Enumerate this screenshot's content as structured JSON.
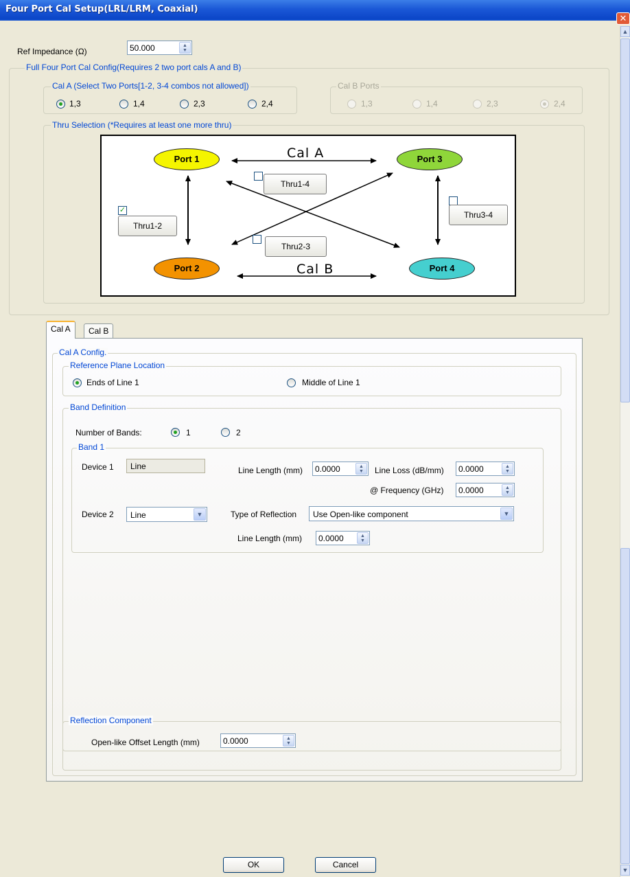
{
  "window": {
    "title": "Four Port Cal Setup(LRL/LRM, Coaxial)",
    "close_glyph": "✕"
  },
  "ref_impedance": {
    "label": "Ref Impedance (Ω)",
    "value": "50.000"
  },
  "full_config": {
    "title": "Full Four Port Cal Config(Requires 2 two port cals A and B)",
    "cal_a_ports": {
      "title": "Cal A (Select Two Ports[1-2, 3-4 combos not allowed])",
      "options": [
        "1,3",
        "1,4",
        "2,3",
        "2,4"
      ],
      "selected": "1,3"
    },
    "cal_b_ports": {
      "title": "Cal B Ports",
      "options": [
        "1,3",
        "1,4",
        "2,3",
        "2,4"
      ],
      "selected": "2,4",
      "enabled": false
    },
    "thru_selection": {
      "title": "Thru Selection (*Requires at least one more thru)",
      "ports": [
        "Port 1",
        "Port 2",
        "Port 3",
        "Port 4"
      ],
      "port_colors": {
        "port1": "#f5f500",
        "port2": "#f39200",
        "port3": "#8fd63a",
        "port4": "#45cfcf"
      },
      "cal_a_label": "Cal A",
      "cal_b_label": "Cal B",
      "thrus": [
        {
          "label": "Thru1-2",
          "checked": true
        },
        {
          "label": "Thru1-4",
          "checked": false
        },
        {
          "label": "Thru2-3",
          "checked": false
        },
        {
          "label": "Thru3-4",
          "checked": false
        }
      ]
    }
  },
  "tabs": [
    {
      "label": "Cal A",
      "active": true
    },
    {
      "label": "Cal B",
      "active": false
    }
  ],
  "cal_a_config": {
    "title": "Cal A Config.",
    "reference_plane": {
      "title": "Reference Plane Location",
      "options": [
        "Ends of Line 1",
        "Middle of Line 1"
      ],
      "selected": "Ends of Line 1"
    },
    "band_definition": {
      "title": "Band Definition",
      "number_of_bands_label": "Number of Bands:",
      "band_options": [
        "1",
        "2"
      ],
      "selected": "1",
      "band1": {
        "title": "Band 1",
        "device1_label": "Device 1",
        "device1_value": "Line",
        "line_length_label": "Line Length (mm)",
        "line_length_value": "0.0000",
        "line_loss_label": "Line Loss (dB/mm)",
        "line_loss_value": "0.0000",
        "frequency_label": "@ Frequency (GHz)",
        "frequency_value": "0.0000",
        "device2_label": "Device 2",
        "device2_value": "Line",
        "type_of_reflection_label": "Type of Reflection",
        "type_of_reflection_value": "Use Open-like component",
        "line_length2_label": "Line Length (mm)",
        "line_length2_value": "0.0000"
      }
    },
    "reflection_component": {
      "title": "Reflection Component",
      "offset_label": "Open-like Offset Length (mm)",
      "offset_value": "0.0000"
    }
  },
  "buttons": {
    "ok": "OK",
    "cancel": "Cancel"
  }
}
